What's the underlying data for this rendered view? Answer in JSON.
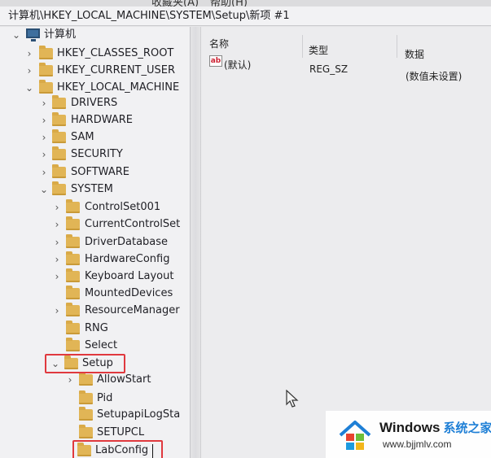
{
  "menu": {
    "favorites": "收藏夹(A)",
    "help": "帮助(H)"
  },
  "address": {
    "path": "计算机\\HKEY_LOCAL_MACHINE\\SYSTEM\\Setup\\新项 #1"
  },
  "tree": {
    "root": "计算机",
    "hives": {
      "classes_root": "HKEY_CLASSES_ROOT",
      "current_user": "HKEY_CURRENT_USER",
      "local_machine": "HKEY_LOCAL_MACHINE"
    },
    "local_machine_children": {
      "drivers": "DRIVERS",
      "hardware": "HARDWARE",
      "sam": "SAM",
      "security": "SECURITY",
      "software": "SOFTWARE",
      "system": "SYSTEM"
    },
    "system_children": {
      "controlset001": "ControlSet001",
      "currentcontrolset": "CurrentControlSet",
      "driverdatabase": "DriverDatabase",
      "hardwareconfig": "HardwareConfig",
      "keyboard_layout": "Keyboard Layout",
      "mounteddevices": "MountedDevices",
      "resourcemanager": "ResourceManager",
      "rng": "RNG",
      "select": "Select",
      "setup": "Setup"
    },
    "setup_children": {
      "allowstart": "AllowStart",
      "pid": "Pid",
      "setupapilogsta": "SetupapiLogSta",
      "setupcl": "SETUPCL",
      "labconfig": "LabConfig"
    }
  },
  "values_pane": {
    "columns": {
      "name": "名称",
      "type": "类型",
      "data": "数据"
    },
    "rows": [
      {
        "name": "(默认)",
        "type": "REG_SZ",
        "data": "(数值未设置)"
      }
    ]
  },
  "watermark": {
    "title": "Windows",
    "title_cn": "系统之家",
    "url": "www.bjjmlv.com"
  },
  "colors": {
    "highlight_box": "#e0393e",
    "folder": "#e1b556",
    "watermark_blue": "#1e7fd6"
  }
}
